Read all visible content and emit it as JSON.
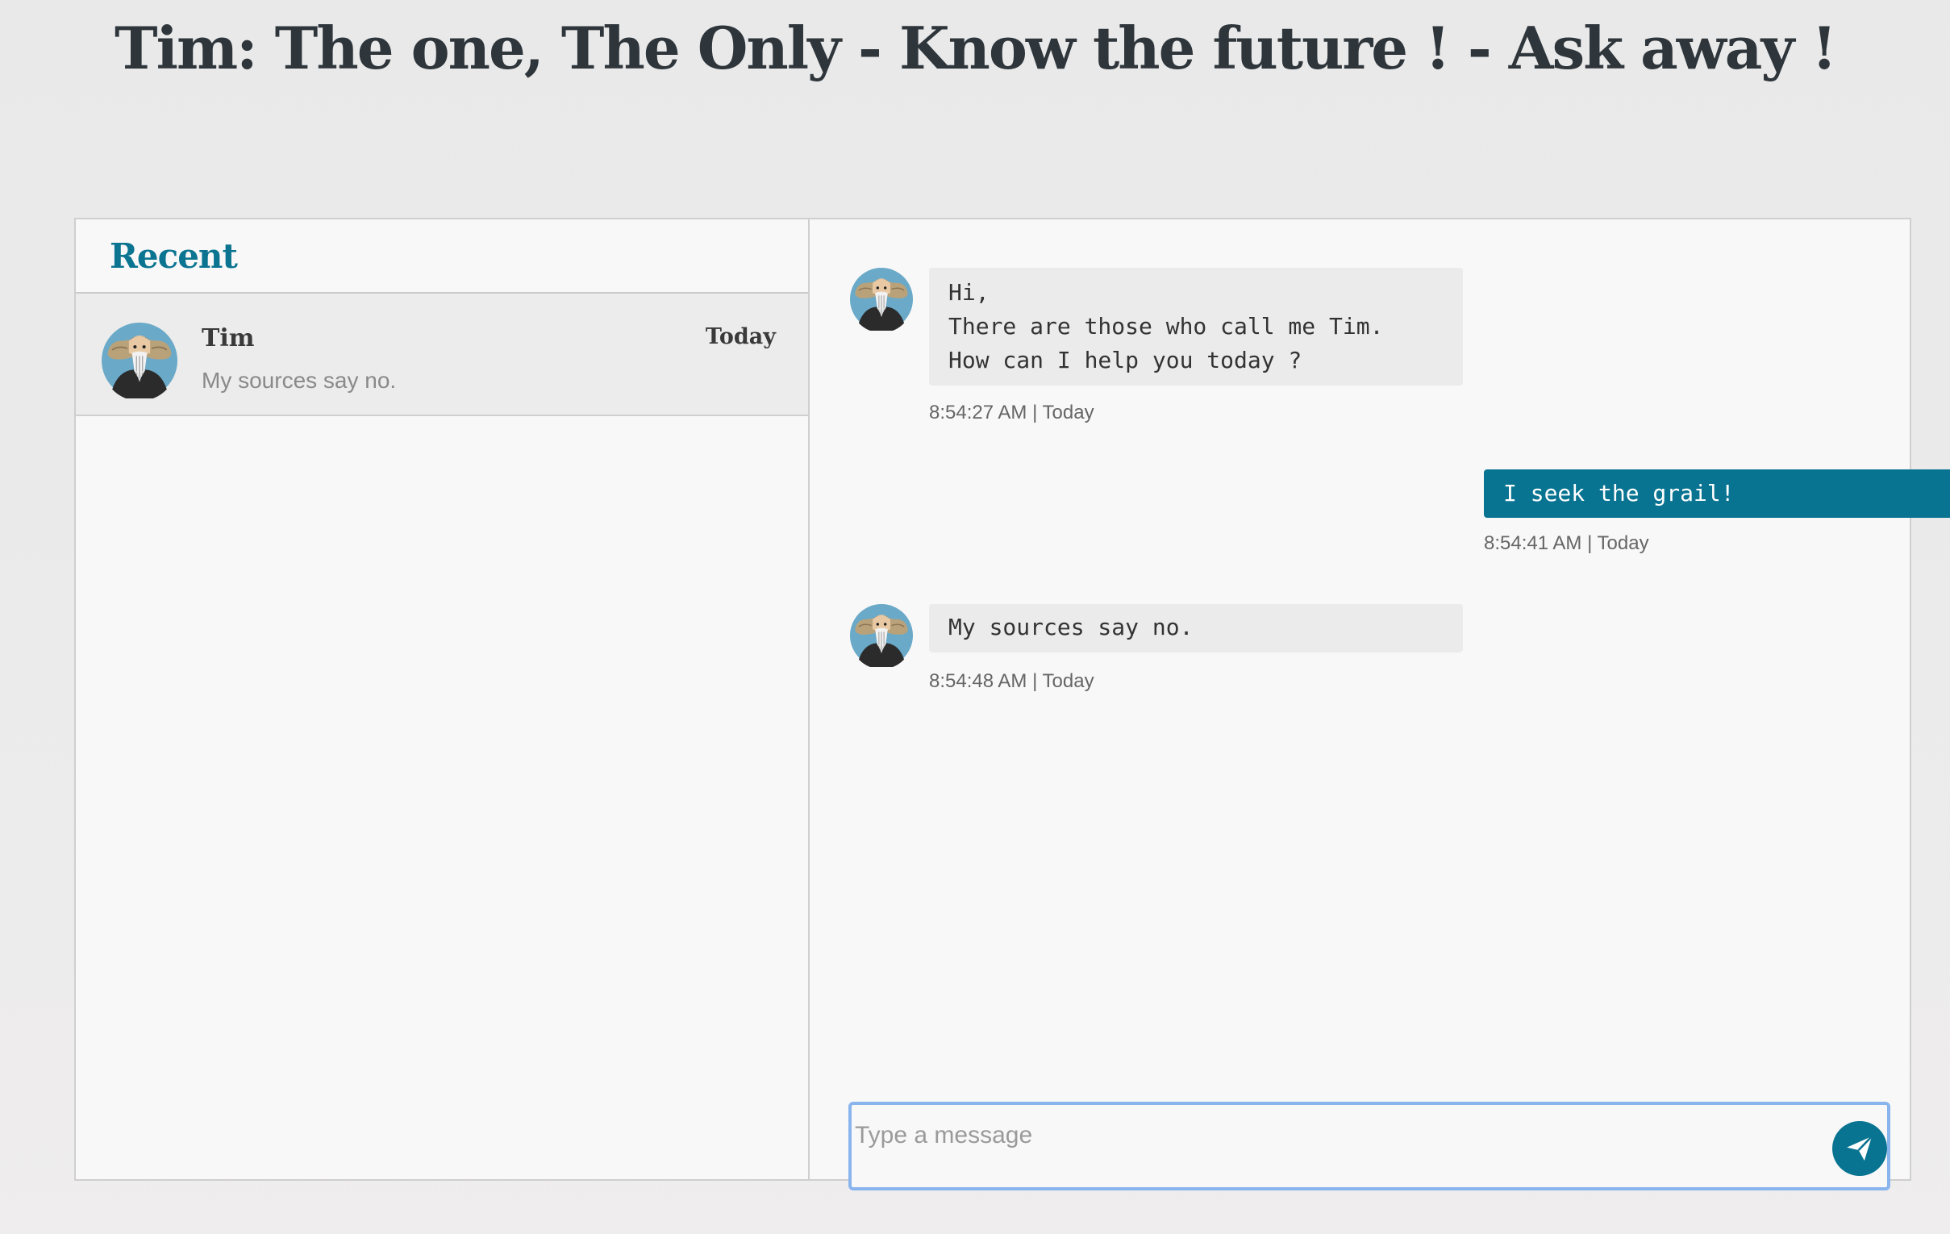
{
  "header": {
    "title": "Tim: The one, The Only - Know the future ! - Ask away !"
  },
  "sidebar": {
    "title": "Recent",
    "conversations": [
      {
        "name": "Tim",
        "date": "Today",
        "preview": "My sources say no.",
        "avatar_icon": "bearded-man-avatar-icon"
      }
    ]
  },
  "thread": {
    "messages": [
      {
        "direction": "incoming",
        "text": "Hi,\nThere are those who call me Tim.\nHow can I help you today ?",
        "meta": "8:54:27 AM | Today"
      },
      {
        "direction": "outgoing",
        "text": "I seek the grail!",
        "meta": "8:54:41 AM | Today"
      },
      {
        "direction": "incoming",
        "text": "My sources say no.",
        "meta": "8:54:48 AM | Today"
      }
    ]
  },
  "composer": {
    "placeholder": "Type a message",
    "value": "",
    "send_icon": "paper-plane-icon"
  },
  "colors": {
    "accent": "#087491",
    "title_text": "#2f363b",
    "incoming_bubble": "#ebebeb",
    "composer_focus_border": "#8ab4ee"
  }
}
